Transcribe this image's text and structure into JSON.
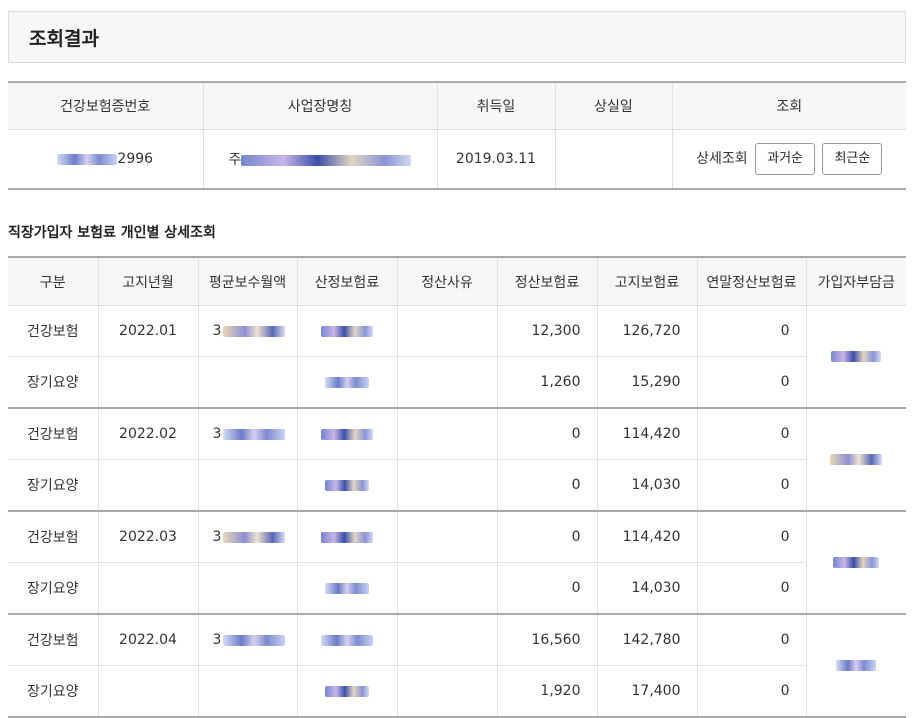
{
  "page_title": "조회결과",
  "summary": {
    "headers": [
      "건강보험증번호",
      "사업장명칭",
      "취득일",
      "상실일",
      "조회"
    ],
    "row": {
      "insurance_no_suffix": "2996",
      "workplace_prefix": "주",
      "acquired_date": "2019.03.11",
      "lost_date": "",
      "detail_label": "상세조회",
      "btn_past": "과거순",
      "btn_recent": "최근순"
    }
  },
  "section_title": "직장가입자 보험료 개인별 상세조회",
  "detail": {
    "headers": [
      "구분",
      "고지년월",
      "평균보수월액",
      "산정보험료",
      "정산사유",
      "정산보험료",
      "고지보험료",
      "연말정산보험료",
      "가입자부담금"
    ],
    "groups": [
      {
        "month": "2022.01",
        "rows": [
          {
            "type": "건강보험",
            "avg_prefix": "3",
            "settle": "12,300",
            "notice": "126,720",
            "yearend": "0"
          },
          {
            "type": "장기요양",
            "avg_prefix": "",
            "settle": "1,260",
            "notice": "15,290",
            "yearend": "0"
          }
        ]
      },
      {
        "month": "2022.02",
        "rows": [
          {
            "type": "건강보험",
            "avg_prefix": "3",
            "settle": "0",
            "notice": "114,420",
            "yearend": "0"
          },
          {
            "type": "장기요양",
            "avg_prefix": "",
            "settle": "0",
            "notice": "14,030",
            "yearend": "0"
          }
        ]
      },
      {
        "month": "2022.03",
        "rows": [
          {
            "type": "건강보험",
            "avg_prefix": "3",
            "settle": "0",
            "notice": "114,420",
            "yearend": "0"
          },
          {
            "type": "장기요양",
            "avg_prefix": "",
            "settle": "0",
            "notice": "14,030",
            "yearend": "0"
          }
        ]
      },
      {
        "month": "2022.04",
        "rows": [
          {
            "type": "건강보험",
            "avg_prefix": "3",
            "settle": "16,560",
            "notice": "142,780",
            "yearend": "0"
          },
          {
            "type": "장기요양",
            "avg_prefix": "",
            "settle": "1,920",
            "notice": "17,400",
            "yearend": "0"
          }
        ]
      }
    ]
  }
}
